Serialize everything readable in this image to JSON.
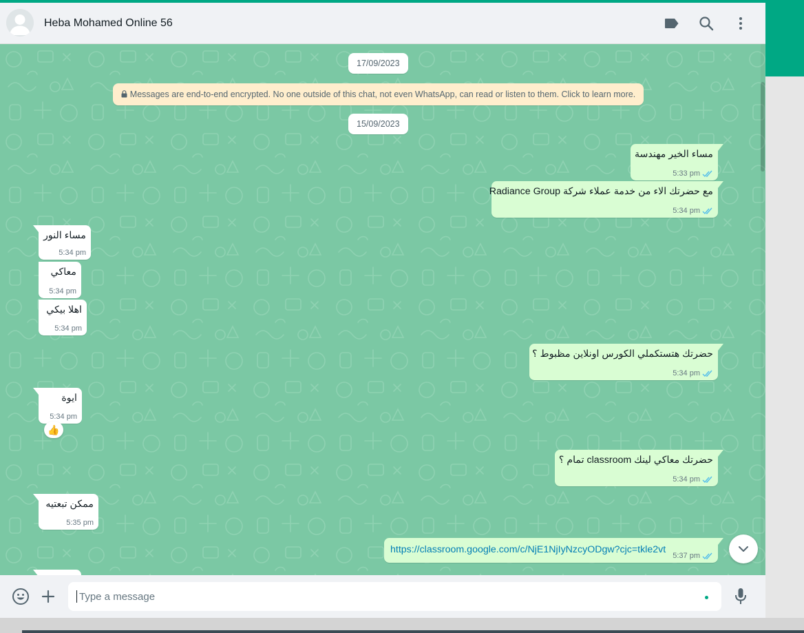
{
  "header": {
    "contact_name": "Heba Mohamed Online 56",
    "icons": [
      "label-icon",
      "search-icon",
      "menu-icon"
    ]
  },
  "chat": {
    "dates": [
      "17/09/2023",
      "15/09/2023"
    ],
    "encryption_notice": "Messages are end-to-end encrypted. No one outside of this chat, not even WhatsApp, can read or listen to them. Click to learn more.",
    "messages": [
      {
        "direction": "out",
        "text": "مساء الخير مهندسة",
        "time": "5:33 pm",
        "status": "read"
      },
      {
        "direction": "out",
        "text": "مع حضرتك الاء من خدمة عملاء شركة Radiance Group",
        "time": "5:34 pm",
        "status": "read"
      },
      {
        "direction": "in",
        "text": "مساء النور",
        "time": "5:34 pm"
      },
      {
        "direction": "in",
        "text": "معاكي",
        "time": "5:34 pm"
      },
      {
        "direction": "in",
        "text": "اهلا بيكي",
        "time": "5:34 pm"
      },
      {
        "direction": "out",
        "text": "حضرتك هتستكملي الكورس اونلاين مظبوط ؟",
        "time": "5:34 pm",
        "status": "read"
      },
      {
        "direction": "in",
        "text": "ايوة",
        "time": "5:34 pm",
        "reaction": "👍"
      },
      {
        "direction": "out",
        "text": "حضرتك معاكي لينك classroom تمام ؟",
        "time": "5:34 pm",
        "status": "read"
      },
      {
        "direction": "in",
        "text": "ممكن تبعتيه",
        "time": "5:35 pm"
      },
      {
        "direction": "out",
        "text": "https://classroom.google.com/c/NjE1NjIyNzcyODgw?cjc=tkle2vt",
        "time": "5:37 pm",
        "status": "read",
        "is_link": true
      }
    ]
  },
  "composer": {
    "placeholder": "Type a message",
    "value": ""
  },
  "colors": {
    "accent": "#00a884",
    "chat_bg": "#7bc8a4",
    "outgoing_bubble": "#d9fdd3",
    "incoming_bubble": "#ffffff",
    "read_ticks": "#53bdeb",
    "link": "#027eb5",
    "notice_bg": "#ffeecd"
  }
}
